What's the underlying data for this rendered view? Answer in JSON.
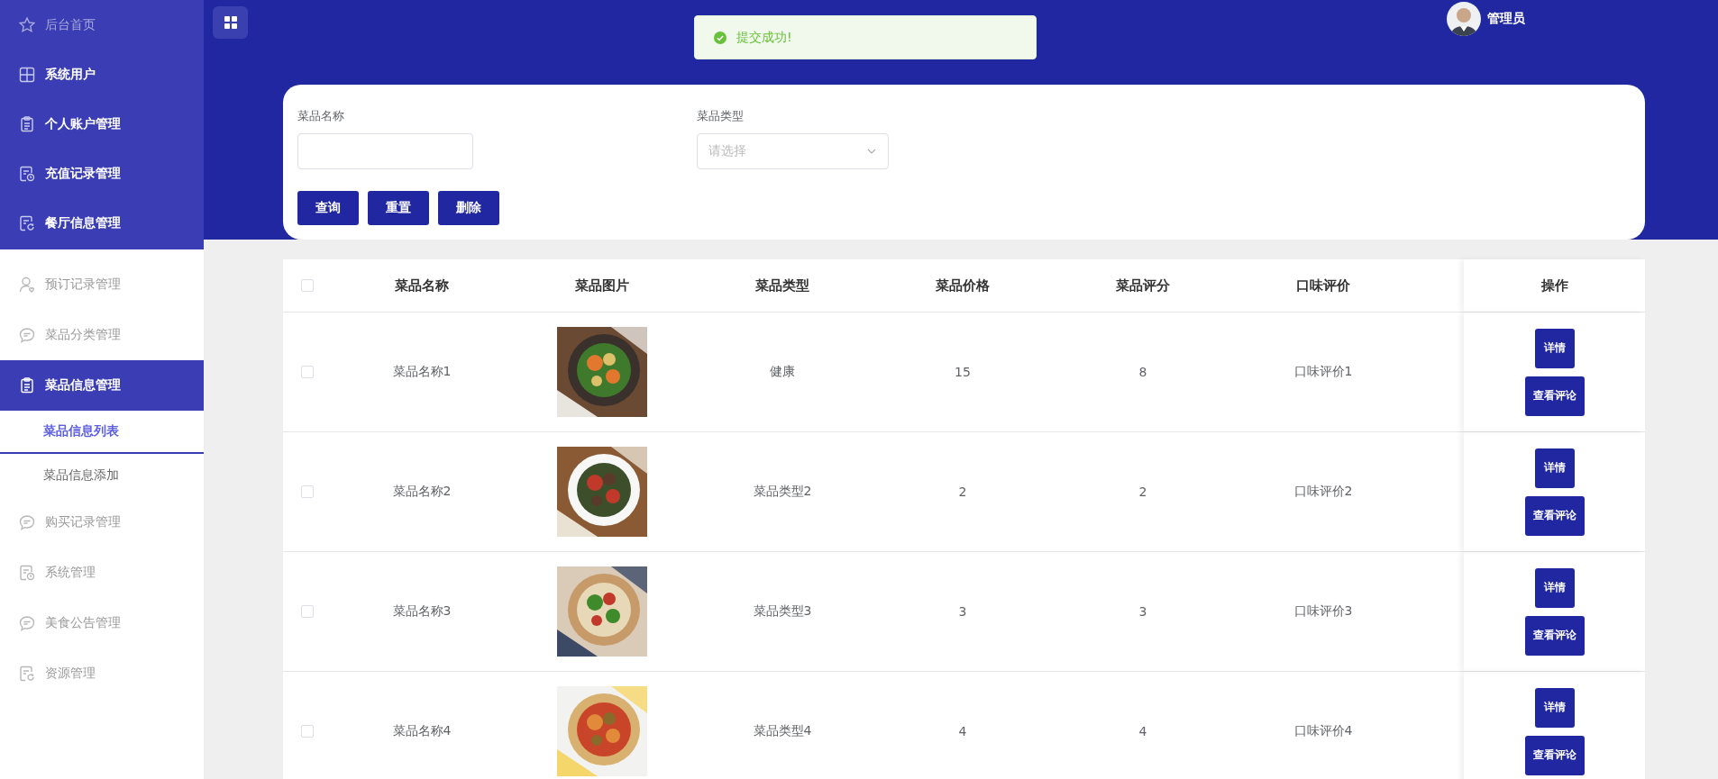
{
  "sidebar": {
    "header_items": [
      {
        "label": "后台首页",
        "muted": true
      },
      {
        "label": "系统用户",
        "muted": false
      },
      {
        "label": "个人账户管理",
        "muted": false
      },
      {
        "label": "充值记录管理",
        "muted": false
      },
      {
        "label": "餐厅信息管理",
        "muted": false
      }
    ],
    "items": [
      {
        "label": "预订记录管理",
        "selected": false
      },
      {
        "label": "菜品分类管理",
        "selected": false
      },
      {
        "label": "菜品信息管理",
        "selected": true,
        "children": [
          {
            "label": "菜品信息列表",
            "selected": true
          },
          {
            "label": "菜品信息添加",
            "selected": false
          }
        ]
      },
      {
        "label": "购买记录管理",
        "selected": false
      },
      {
        "label": "系统管理",
        "selected": false
      },
      {
        "label": "美食公告管理",
        "selected": false
      },
      {
        "label": "资源管理",
        "selected": false
      }
    ]
  },
  "user": {
    "name": "管理员"
  },
  "toast": {
    "message": "提交成功!"
  },
  "search": {
    "fields": [
      {
        "kind": "text",
        "label": "菜品名称"
      },
      {
        "kind": "select",
        "label": "菜品类型",
        "placeholder": "请选择"
      }
    ],
    "buttons": [
      "查询",
      "重置",
      "删除"
    ]
  },
  "table": {
    "header_checked": false,
    "columns": [
      "菜品名称",
      "菜品图片",
      "菜品类型",
      "菜品价格",
      "菜品评分",
      "口味评价",
      "操作"
    ],
    "rows": [
      {
        "checked": false,
        "name": "菜品名称1",
        "image": {
          "kind": "picture"
        },
        "type": "健康",
        "price": "15",
        "score": "8",
        "taste": "口味评价1",
        "actions": [
          "详情",
          "查看评论"
        ]
      },
      {
        "checked": false,
        "name": "菜品名称2",
        "image": {
          "kind": "picture"
        },
        "type": "菜品类型2",
        "price": "2",
        "score": "2",
        "taste": "口味评价2",
        "actions": [
          "详情",
          "查看评论"
        ]
      },
      {
        "checked": false,
        "name": "菜品名称3",
        "image": {
          "kind": "picture"
        },
        "type": "菜品类型3",
        "price": "3",
        "score": "3",
        "taste": "口味评价3",
        "actions": [
          "详情",
          "查看评论"
        ]
      },
      {
        "checked": false,
        "name": "菜品名称4",
        "image": {
          "kind": "picture"
        },
        "type": "菜品类型4",
        "price": "4",
        "score": "4",
        "taste": "口味评价4",
        "actions": [
          "详情",
          "查看评论"
        ]
      }
    ]
  }
}
